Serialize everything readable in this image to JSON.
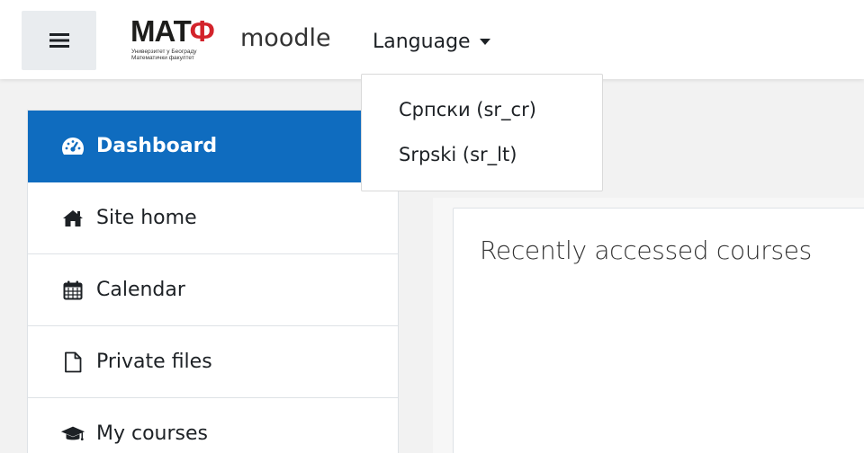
{
  "navbar": {
    "logo": {
      "mark_main": "МАТ",
      "mark_accent": "Ф",
      "subtitle_line1": "Универзитет у Београду",
      "subtitle_line2": "Математички факултет",
      "app_name": "moodle"
    },
    "language_label": "Language"
  },
  "language_menu": {
    "items": [
      {
        "label": "Српски (sr_cr)"
      },
      {
        "label": "Srpski (sr_lt)"
      }
    ]
  },
  "sidebar": {
    "items": [
      {
        "label": "Dashboard",
        "icon": "dashboard-icon",
        "active": true
      },
      {
        "label": "Site home",
        "icon": "home-icon"
      },
      {
        "label": "Calendar",
        "icon": "calendar-icon"
      },
      {
        "label": "Private files",
        "icon": "file-icon"
      },
      {
        "label": "My courses",
        "icon": "graduation-cap-icon"
      }
    ]
  },
  "main": {
    "card_title": "Recently accessed courses"
  },
  "colors": {
    "accent": "#0f6cbf",
    "logo_red": "#d3232b",
    "background": "#f2f2f2"
  }
}
